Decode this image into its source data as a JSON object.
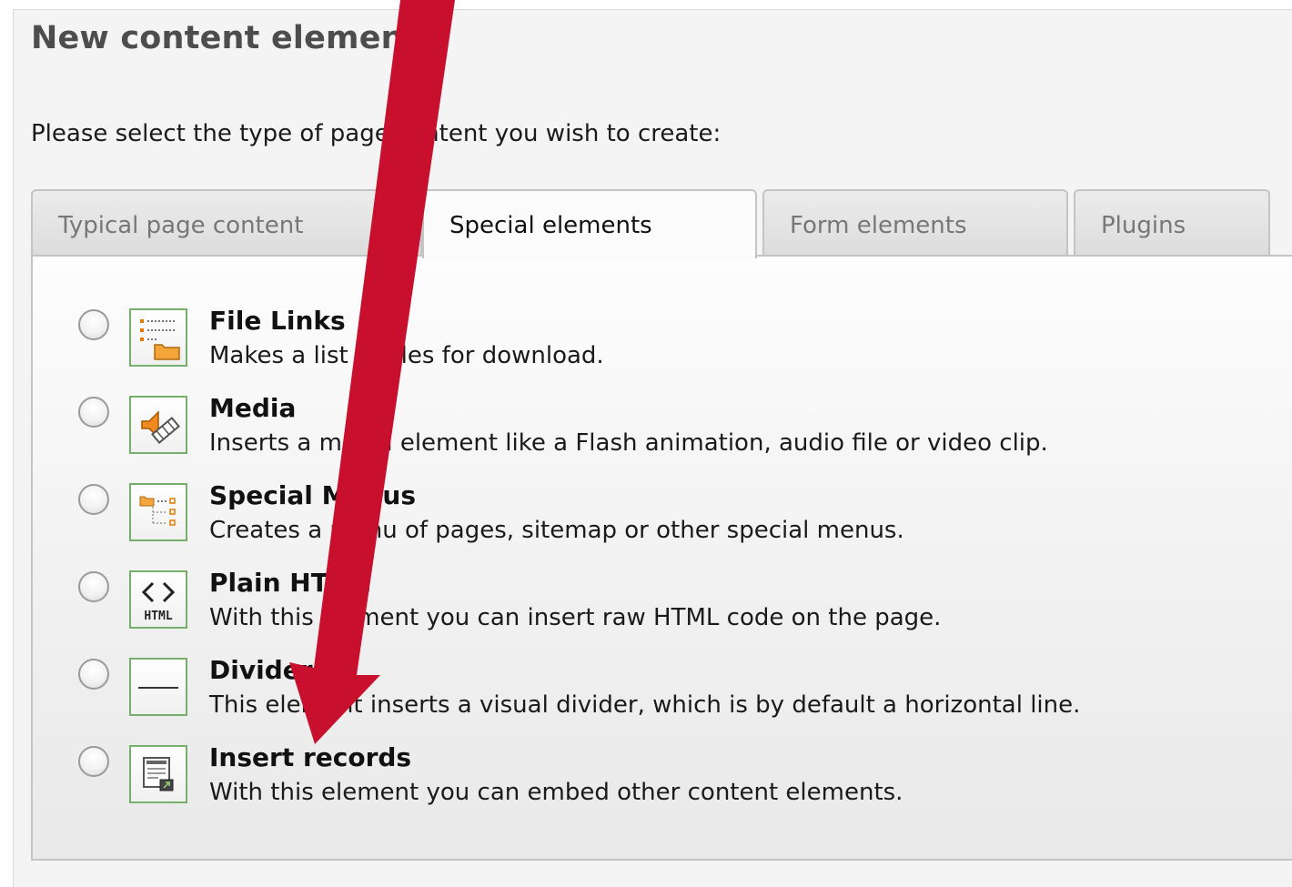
{
  "header": {
    "title": "New content element",
    "instruction": "Please select the type of page content you wish to create:"
  },
  "tabs": [
    {
      "label": "Typical page content",
      "active": false
    },
    {
      "label": "Special elements",
      "active": true
    },
    {
      "label": "Form elements",
      "active": false
    },
    {
      "label": "Plugins",
      "active": false
    }
  ],
  "elements": [
    {
      "title": "File Links",
      "description": "Makes a list of files for download.",
      "icon": "file-links-icon"
    },
    {
      "title": "Media",
      "description": "Inserts a media element like a Flash animation, audio file or video clip.",
      "icon": "media-icon"
    },
    {
      "title": "Special Menus",
      "description": "Creates a menu of pages, sitemap or other special menus.",
      "icon": "special-menus-icon"
    },
    {
      "title": "Plain HTML",
      "description": "With this element you can insert raw HTML code on the page.",
      "icon": "plain-html-icon",
      "icon_text": "HTML"
    },
    {
      "title": "Divider",
      "description": "This element inserts a visual divider, which is by default a horizontal line.",
      "icon": "divider-icon"
    },
    {
      "title": "Insert records",
      "description": "With this element you can embed other content elements.",
      "icon": "insert-records-icon"
    }
  ],
  "overlay": {
    "arrow_color": "#c8102e",
    "icon": "annotation-arrow"
  }
}
